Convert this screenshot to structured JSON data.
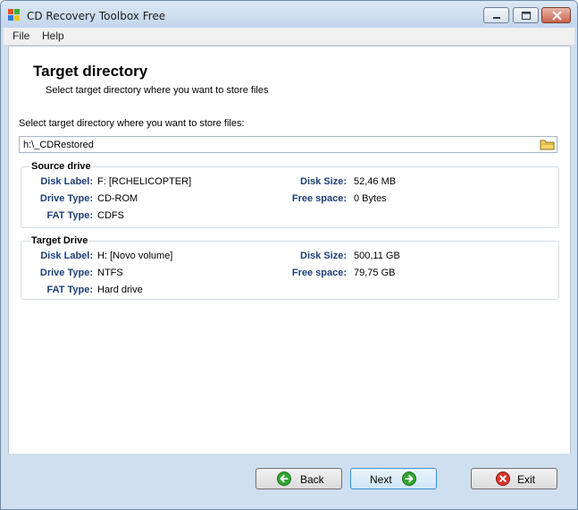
{
  "window": {
    "title": "CD Recovery Toolbox Free"
  },
  "menu": {
    "file": "File",
    "help": "Help"
  },
  "page": {
    "heading": "Target directory",
    "subheading": "Select target directory where you want to store files",
    "prompt": "Select target directory where you want to store files:",
    "path_value": "h:\\_CDRestored"
  },
  "source_drive": {
    "title": "Source drive",
    "disk_label": {
      "label": "Disk Label:",
      "value": "F: [RCHELICOPTER]"
    },
    "drive_type": {
      "label": "Drive Type:",
      "value": "CD-ROM"
    },
    "fat_type": {
      "label": "FAT Type:",
      "value": "CDFS"
    },
    "disk_size": {
      "label": "Disk Size:",
      "value": "52,46 MB"
    },
    "free_space": {
      "label": "Free space:",
      "value": "0 Bytes"
    }
  },
  "target_drive": {
    "title": "Target Drive",
    "disk_label": {
      "label": "Disk Label:",
      "value": "H: [Novo volume]"
    },
    "drive_type": {
      "label": "Drive Type:",
      "value": "NTFS"
    },
    "fat_type": {
      "label": "FAT Type:",
      "value": "Hard drive"
    },
    "disk_size": {
      "label": "Disk Size:",
      "value": "500,11 GB"
    },
    "free_space": {
      "label": "Free space:",
      "value": "79,75 GB"
    }
  },
  "buttons": {
    "back": "Back",
    "next": "Next",
    "exit": "Exit"
  },
  "colors": {
    "label_blue": "#1d3f78",
    "frame": "#cfdff0",
    "back_icon": "#2fa830",
    "next_icon": "#2fa830",
    "exit_icon": "#d9362c"
  },
  "icons": {
    "app": "app-icon",
    "folder": "folder-icon",
    "back": "back-arrow-icon",
    "next": "next-arrow-icon",
    "exit": "exit-x-icon"
  }
}
